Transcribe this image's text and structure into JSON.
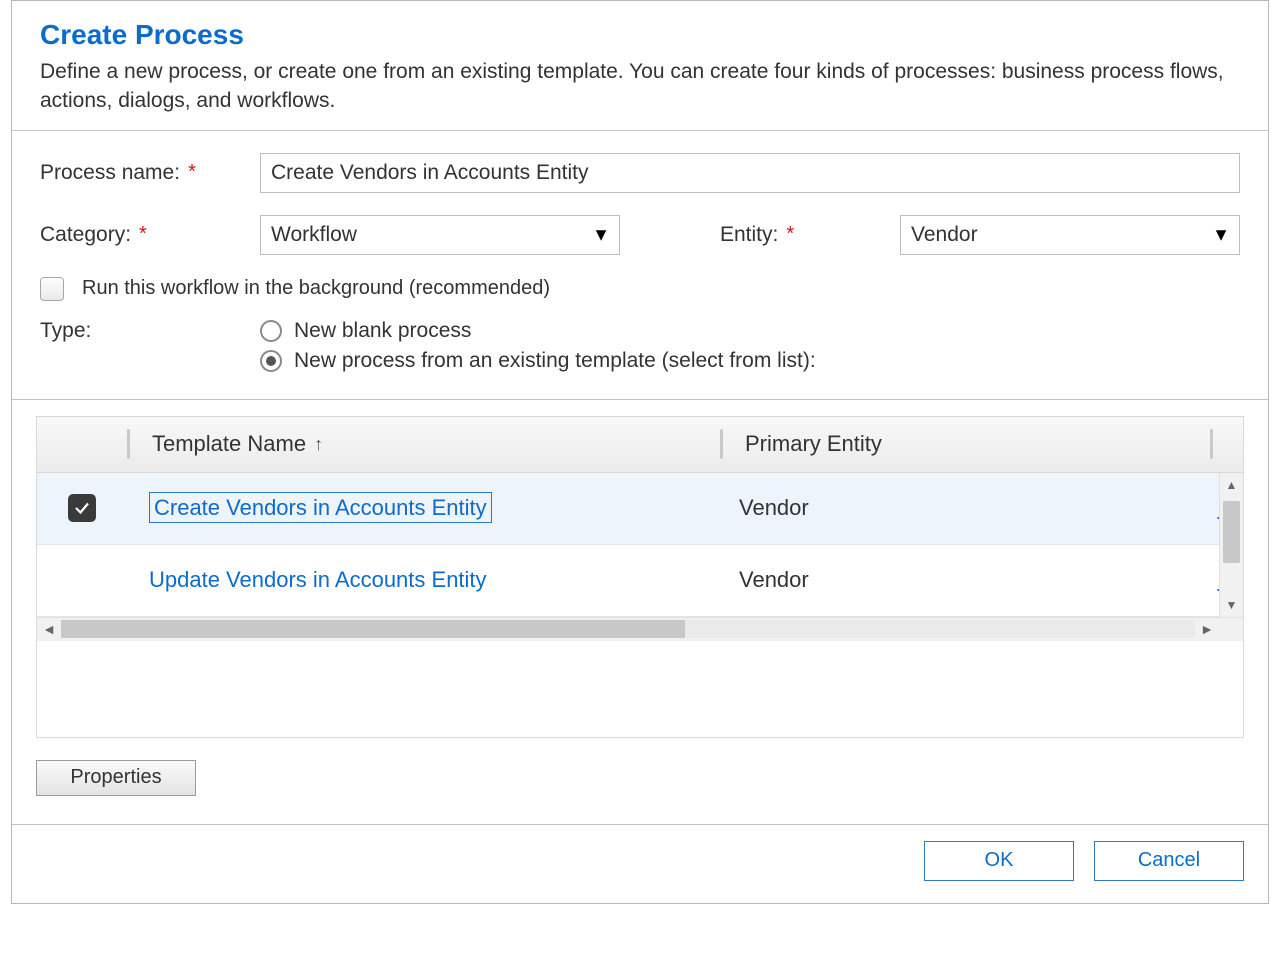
{
  "header": {
    "title": "Create Process",
    "subtitle": "Define a new process, or create one from an existing template. You can create four kinds of processes: business process flows, actions, dialogs, and workflows."
  },
  "form": {
    "process_name_label": "Process name:",
    "process_name_value": "Create Vendors in Accounts Entity",
    "category_label": "Category:",
    "category_value": "Workflow",
    "entity_label": "Entity:",
    "entity_value": "Vendor",
    "run_background_label": "Run this workflow in the background (recommended)",
    "type_label": "Type:",
    "type_options": {
      "blank": "New blank process",
      "template": "New process from an existing template (select from list):"
    }
  },
  "grid": {
    "columns": {
      "name": "Template Name",
      "entity": "Primary Entity"
    },
    "rows": [
      {
        "name": "Create Vendors in Accounts Entity",
        "entity": "Vendor",
        "owner_abbrev": "Bi",
        "selected": true
      },
      {
        "name": "Update Vendors in Accounts Entity",
        "entity": "Vendor",
        "owner_abbrev": "Bi",
        "selected": false
      }
    ]
  },
  "buttons": {
    "properties": "Properties",
    "ok": "OK",
    "cancel": "Cancel"
  }
}
